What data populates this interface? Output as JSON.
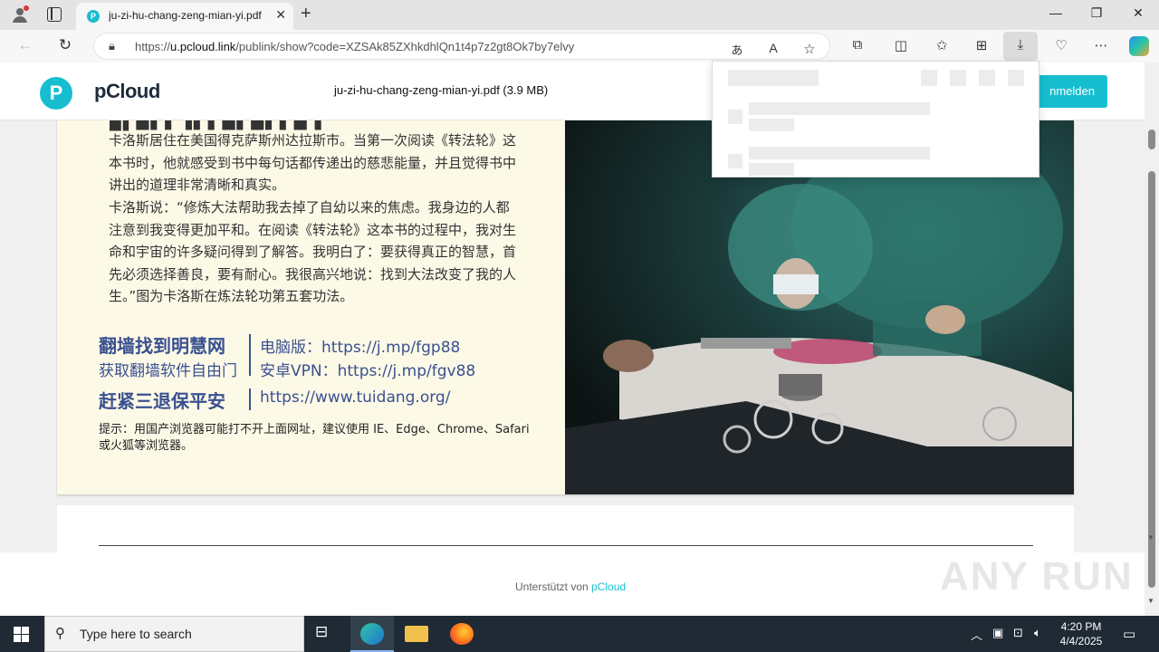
{
  "browser": {
    "tab_title": "ju-zi-hu-chang-zeng-mian-yi.pdf",
    "tab_favicon_letter": "P",
    "url_prefix": "https://",
    "url_host": "u.pcloud.link",
    "url_path": "/publink/show?code=XZSAk85ZXhkdhlQn1t4p7z2gt8Ok7by7elvy",
    "icons": [
      "back-icon",
      "refresh-icon",
      "lock-icon",
      "translate-icon",
      "read-aloud-icon",
      "favorite-star-icon",
      "extensions-icon",
      "split-screen-icon",
      "favorites-icon",
      "collections-icon",
      "downloads-icon",
      "performance-icon",
      "more-icon",
      "copilot-icon"
    ]
  },
  "pcloud": {
    "brand": "pCloud",
    "logo_letter": "P",
    "file_label": "ju-zi-hu-chang-zeng-mian-yi.pdf (3.9 MB)",
    "signin_label": "nmelden",
    "footer_prefix": "Unterstützt von ",
    "footer_link": "pCloud",
    "accent": "#17bed0"
  },
  "pdf": {
    "paragraph1": "卡洛斯居住在美国得克萨斯州达拉斯市。当第一次阅读《转法轮》这本书时，他就感受到书中每句话都传递出的慈悲能量，并且觉得书中讲出的道理非常清晰和真实。",
    "paragraph2": "卡洛斯说：“修炼大法帮助我去掉了自幼以来的焦虑。我身边的人都注意到我变得更加平和。在阅读《转法轮》这本书的过程中，我对生命和宇宙的许多疑问得到了解答。我明白了：要获得真正的智慧，首先必须选择善良，要有耐心。我很高兴地说：找到大法改变了我的人生。”图为卡洛斯在炼法轮功第五套功法。",
    "promo_title": "翻墙找到明慧网",
    "promo_subtitle": "获取翻墙软件自由门",
    "link_pc": "电脑版：https://j.mp/fgp88",
    "link_android": "安卓VPN：https://j.mp/fgv88",
    "promo_title2": "赶紧三退保平安",
    "link_tuidang": "https://www.tuidang.org/",
    "tip": "提示：用国产浏览器可能打不开上面网址，建议使用 IE、Edge、Chrome、Safari 或火狐等浏览器。"
  },
  "watermark": "ANY RUN",
  "taskbar": {
    "search_placeholder": "Type here to search",
    "time": "4:20 PM",
    "date": "4/4/2025"
  }
}
